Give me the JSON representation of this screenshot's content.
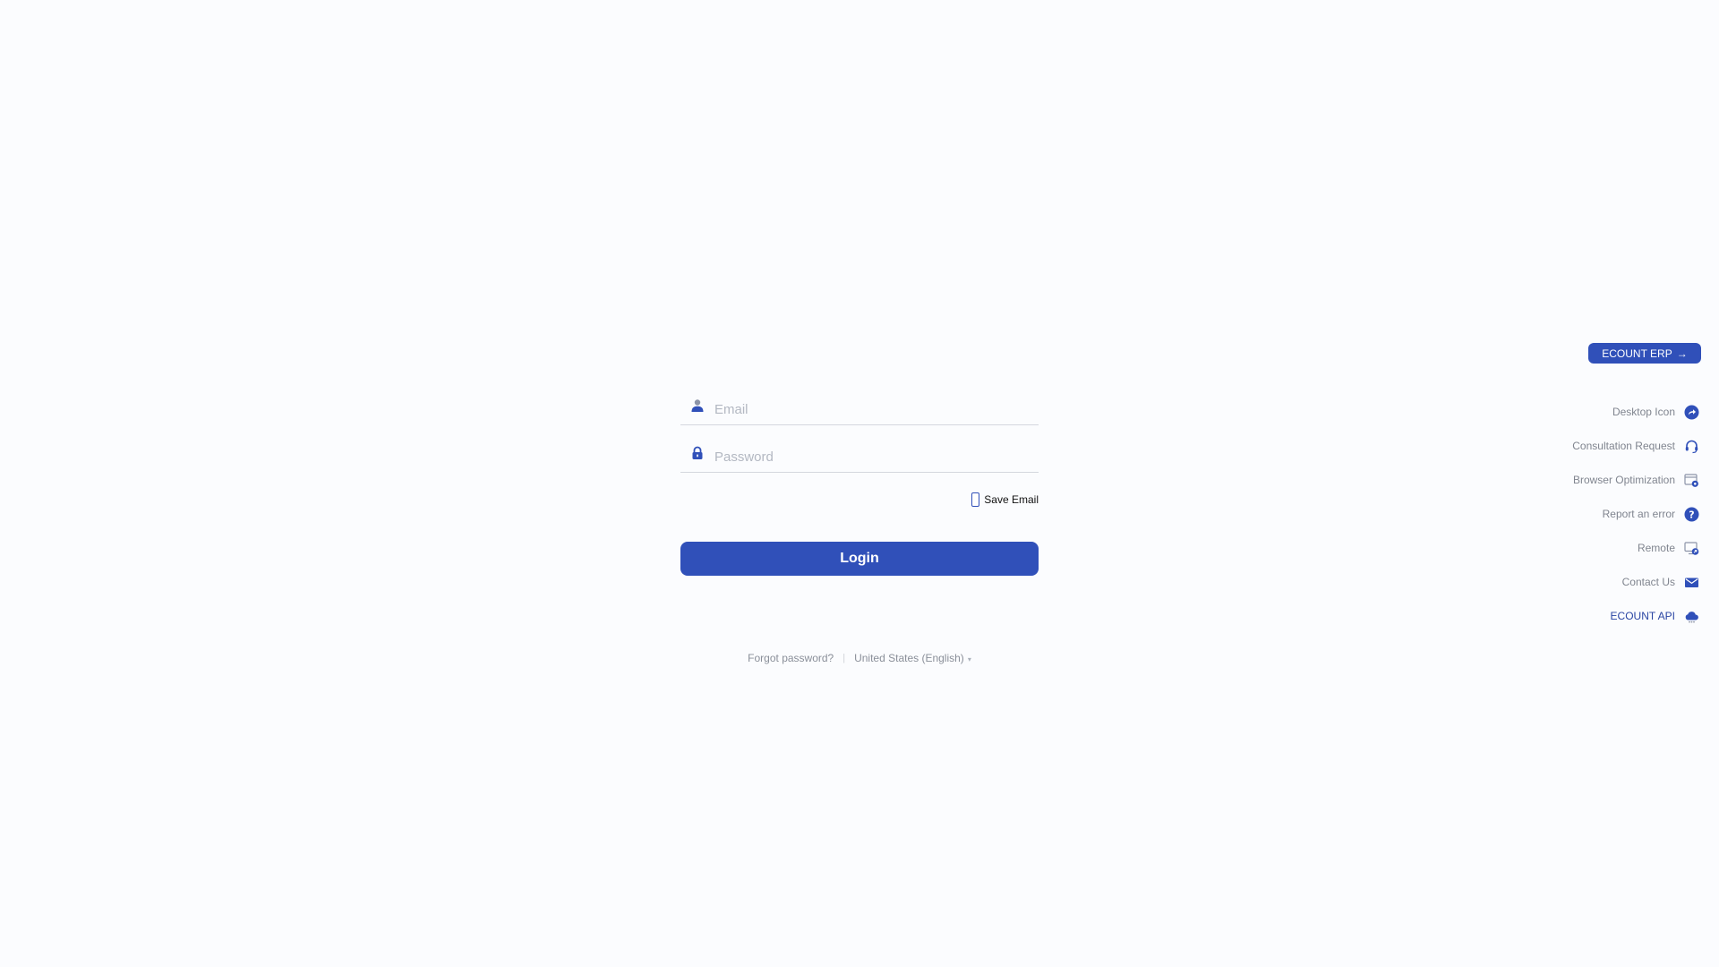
{
  "login": {
    "email_placeholder": "Email",
    "password_placeholder": "Password",
    "save_email_label": "Save Email",
    "login_label": "Login"
  },
  "footer": {
    "forgot_password": "Forgot password?",
    "separator": "|",
    "language": "United States (English)",
    "language_caret": "▾"
  },
  "side": {
    "erp_button": "ECOUNT ERP",
    "erp_arrow": "→",
    "items": [
      {
        "label": "Desktop Icon",
        "icon": "share-arrow-icon"
      },
      {
        "label": "Consultation Request",
        "icon": "headset-icon"
      },
      {
        "label": "Browser Optimization",
        "icon": "browser-gear-icon"
      },
      {
        "label": "Report an error",
        "icon": "question-icon"
      },
      {
        "label": "Remote",
        "icon": "remote-monitor-icon"
      },
      {
        "label": "Contact Us",
        "icon": "mail-icon"
      },
      {
        "label": "ECOUNT API",
        "icon": "cloud-icon"
      }
    ]
  },
  "colors": {
    "accent": "#3050b9",
    "background": "#fbfcfe",
    "muted_text": "#80858f"
  }
}
